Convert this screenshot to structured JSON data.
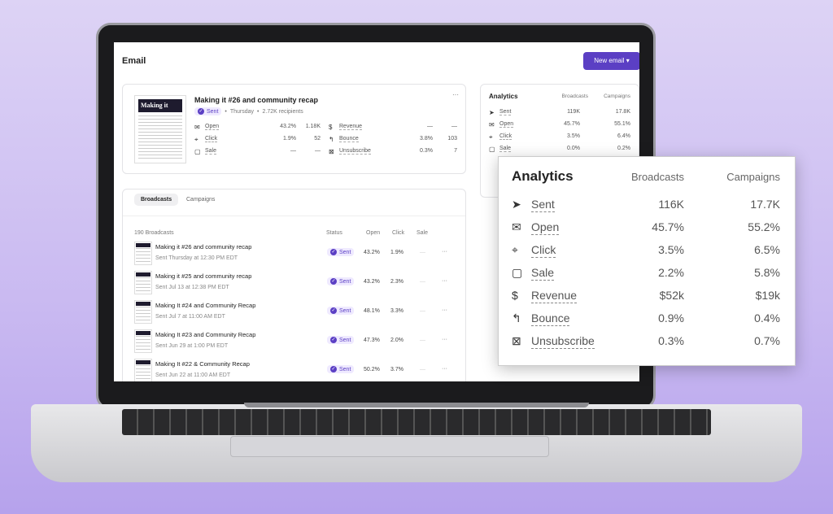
{
  "header": {
    "title": "Email",
    "new_email_button": "New email ▾"
  },
  "featured": {
    "thumb_title": "Making it",
    "title": "Making it #26 and community recap",
    "status": "Sent",
    "day": "Thursday",
    "recipients": "2.72K recipients",
    "more": "···",
    "left_metrics": [
      {
        "icon": "envelope-open-icon",
        "glyph": "✉",
        "label": "Open",
        "pct": "43.2%",
        "count": "1.18K"
      },
      {
        "icon": "click-icon",
        "glyph": "⌖",
        "label": "Click",
        "pct": "1.9%",
        "count": "52"
      },
      {
        "icon": "bag-icon",
        "glyph": "▢",
        "label": "Sale",
        "pct": "—",
        "count": "—"
      }
    ],
    "right_metrics": [
      {
        "icon": "dollar-icon",
        "glyph": "$",
        "label": "Revenue",
        "pct": "—",
        "count": "—"
      },
      {
        "icon": "bounce-icon",
        "glyph": "↰",
        "label": "Bounce",
        "pct": "3.8%",
        "count": "103"
      },
      {
        "icon": "x-box-icon",
        "glyph": "⊠",
        "label": "Unsubscribe",
        "pct": "0.3%",
        "count": "7"
      }
    ]
  },
  "analytics_small": {
    "title": "Analytics",
    "col_broadcasts": "Broadcasts",
    "col_campaigns": "Campaigns",
    "rows": [
      {
        "icon": "send-icon",
        "glyph": "➤",
        "label": "Sent",
        "b": "119K",
        "c": "17.8K"
      },
      {
        "icon": "envelope-open-icon",
        "glyph": "✉",
        "label": "Open",
        "b": "45.7%",
        "c": "55.1%"
      },
      {
        "icon": "click-icon",
        "glyph": "⌖",
        "label": "Click",
        "b": "3.5%",
        "c": "6.4%"
      },
      {
        "icon": "bag-icon",
        "glyph": "▢",
        "label": "Sale",
        "b": "0.0%",
        "c": "0.2%"
      }
    ]
  },
  "analytics_zoom": {
    "title": "Analytics",
    "col_broadcasts": "Broadcasts",
    "col_campaigns": "Campaigns",
    "rows": [
      {
        "icon": "send-icon",
        "glyph": "➤",
        "label": "Sent",
        "b": "116K",
        "c": "17.7K"
      },
      {
        "icon": "envelope-open-icon",
        "glyph": "✉",
        "label": "Open",
        "b": "45.7%",
        "c": "55.2%"
      },
      {
        "icon": "click-icon",
        "glyph": "⌖",
        "label": "Click",
        "b": "3.5%",
        "c": "6.5%"
      },
      {
        "icon": "bag-icon",
        "glyph": "▢",
        "label": "Sale",
        "b": "2.2%",
        "c": "5.8%"
      },
      {
        "icon": "dollar-icon",
        "glyph": "$",
        "label": "Revenue",
        "b": "$52k",
        "c": "$19k"
      },
      {
        "icon": "bounce-icon",
        "glyph": "↰",
        "label": "Bounce",
        "b": "0.9%",
        "c": "0.4%"
      },
      {
        "icon": "x-box-icon",
        "glyph": "⊠",
        "label": "Unsubscribe",
        "b": "0.3%",
        "c": "0.7%"
      }
    ]
  },
  "list": {
    "tabs": [
      {
        "label": "Broadcasts",
        "active": true
      },
      {
        "label": "Campaigns",
        "active": false
      }
    ],
    "count": "190 Broadcasts",
    "columns": {
      "status": "Status",
      "open": "Open",
      "click": "Click",
      "sale": "Sale"
    },
    "rows": [
      {
        "title": "Making it #26 and community recap",
        "sub": "Sent Thursday at 12:30 PM EDT",
        "status": "Sent",
        "open": "43.2%",
        "click": "1.9%",
        "sale": "—",
        "more": "···"
      },
      {
        "title": "Making it #25 and community recap",
        "sub": "Sent Jul 13 at 12:38 PM EDT",
        "status": "Sent",
        "open": "43.2%",
        "click": "2.3%",
        "sale": "—",
        "more": "···"
      },
      {
        "title": "Making It #24 and Community Recap",
        "sub": "Sent Jul 7 at 11:00 AM EDT",
        "status": "Sent",
        "open": "48.1%",
        "click": "3.3%",
        "sale": "—",
        "more": "···"
      },
      {
        "title": "Making It #23 and Community Recap",
        "sub": "Sent Jun 29 at 1:00 PM EDT",
        "status": "Sent",
        "open": "47.3%",
        "click": "2.0%",
        "sale": "—",
        "more": "···"
      },
      {
        "title": "Making It #22 & Community Recap",
        "sub": "Sent Jun 22 at 11:00 AM EDT",
        "status": "Sent",
        "open": "50.2%",
        "click": "3.7%",
        "sale": "—",
        "more": "···"
      }
    ]
  },
  "colors": {
    "accent": "#5b3fc4",
    "background": "#c9b9f1"
  }
}
